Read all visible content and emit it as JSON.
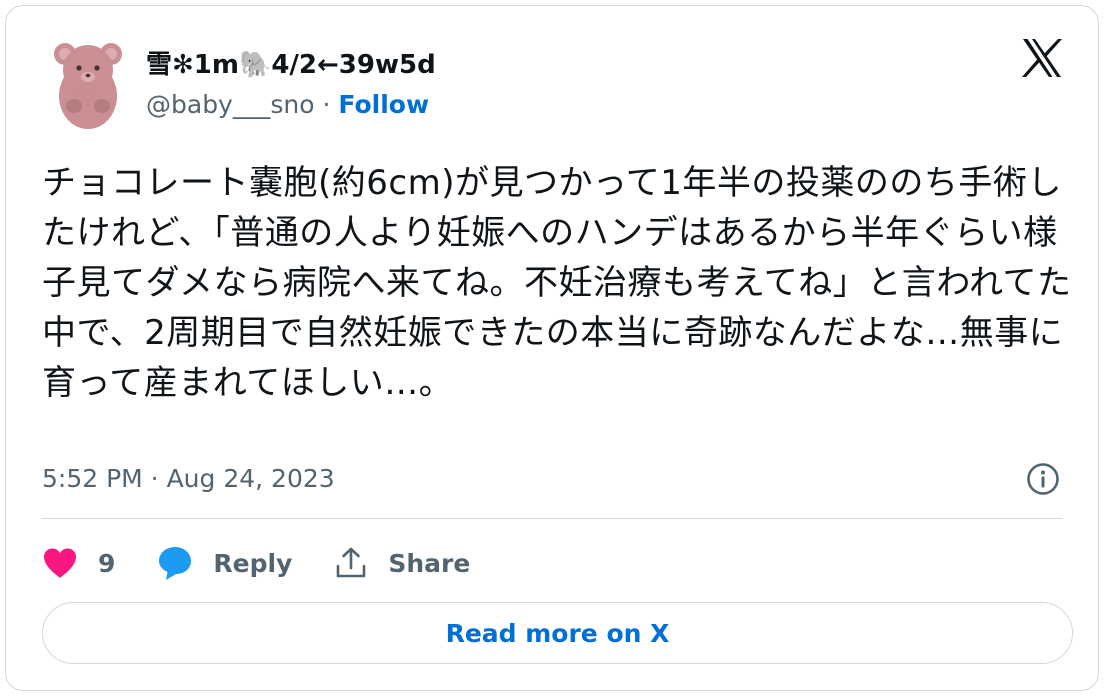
{
  "author": {
    "display_name": "雪✻1m🐘4/2←39w5d",
    "handle": "@baby___sno",
    "separator": "·",
    "follow_label": "Follow"
  },
  "tweet": {
    "text": "チョコレート嚢胞(約6cm)が見つかって1年半の投薬ののち手術したけれど、「普通の人より妊娠へのハンデはあるから半年ぐらい様子見てダメなら病院へ来てね。不妊治療も考えてね」と言われてた中で、2周期目で自然妊娠できたの本当に奇跡なんだよな…無事に育って産まれてほしい…。",
    "timestamp": "5:52 PM · Aug 24, 2023"
  },
  "actions": {
    "like_count": "9",
    "reply_label": "Reply",
    "share_label": "Share"
  },
  "read_more_label": "Read more on X",
  "colors": {
    "like": "#f91880",
    "reply": "#1d9bf0",
    "link": "#006fd6",
    "muted": "#536471",
    "border": "#cfd9de"
  }
}
